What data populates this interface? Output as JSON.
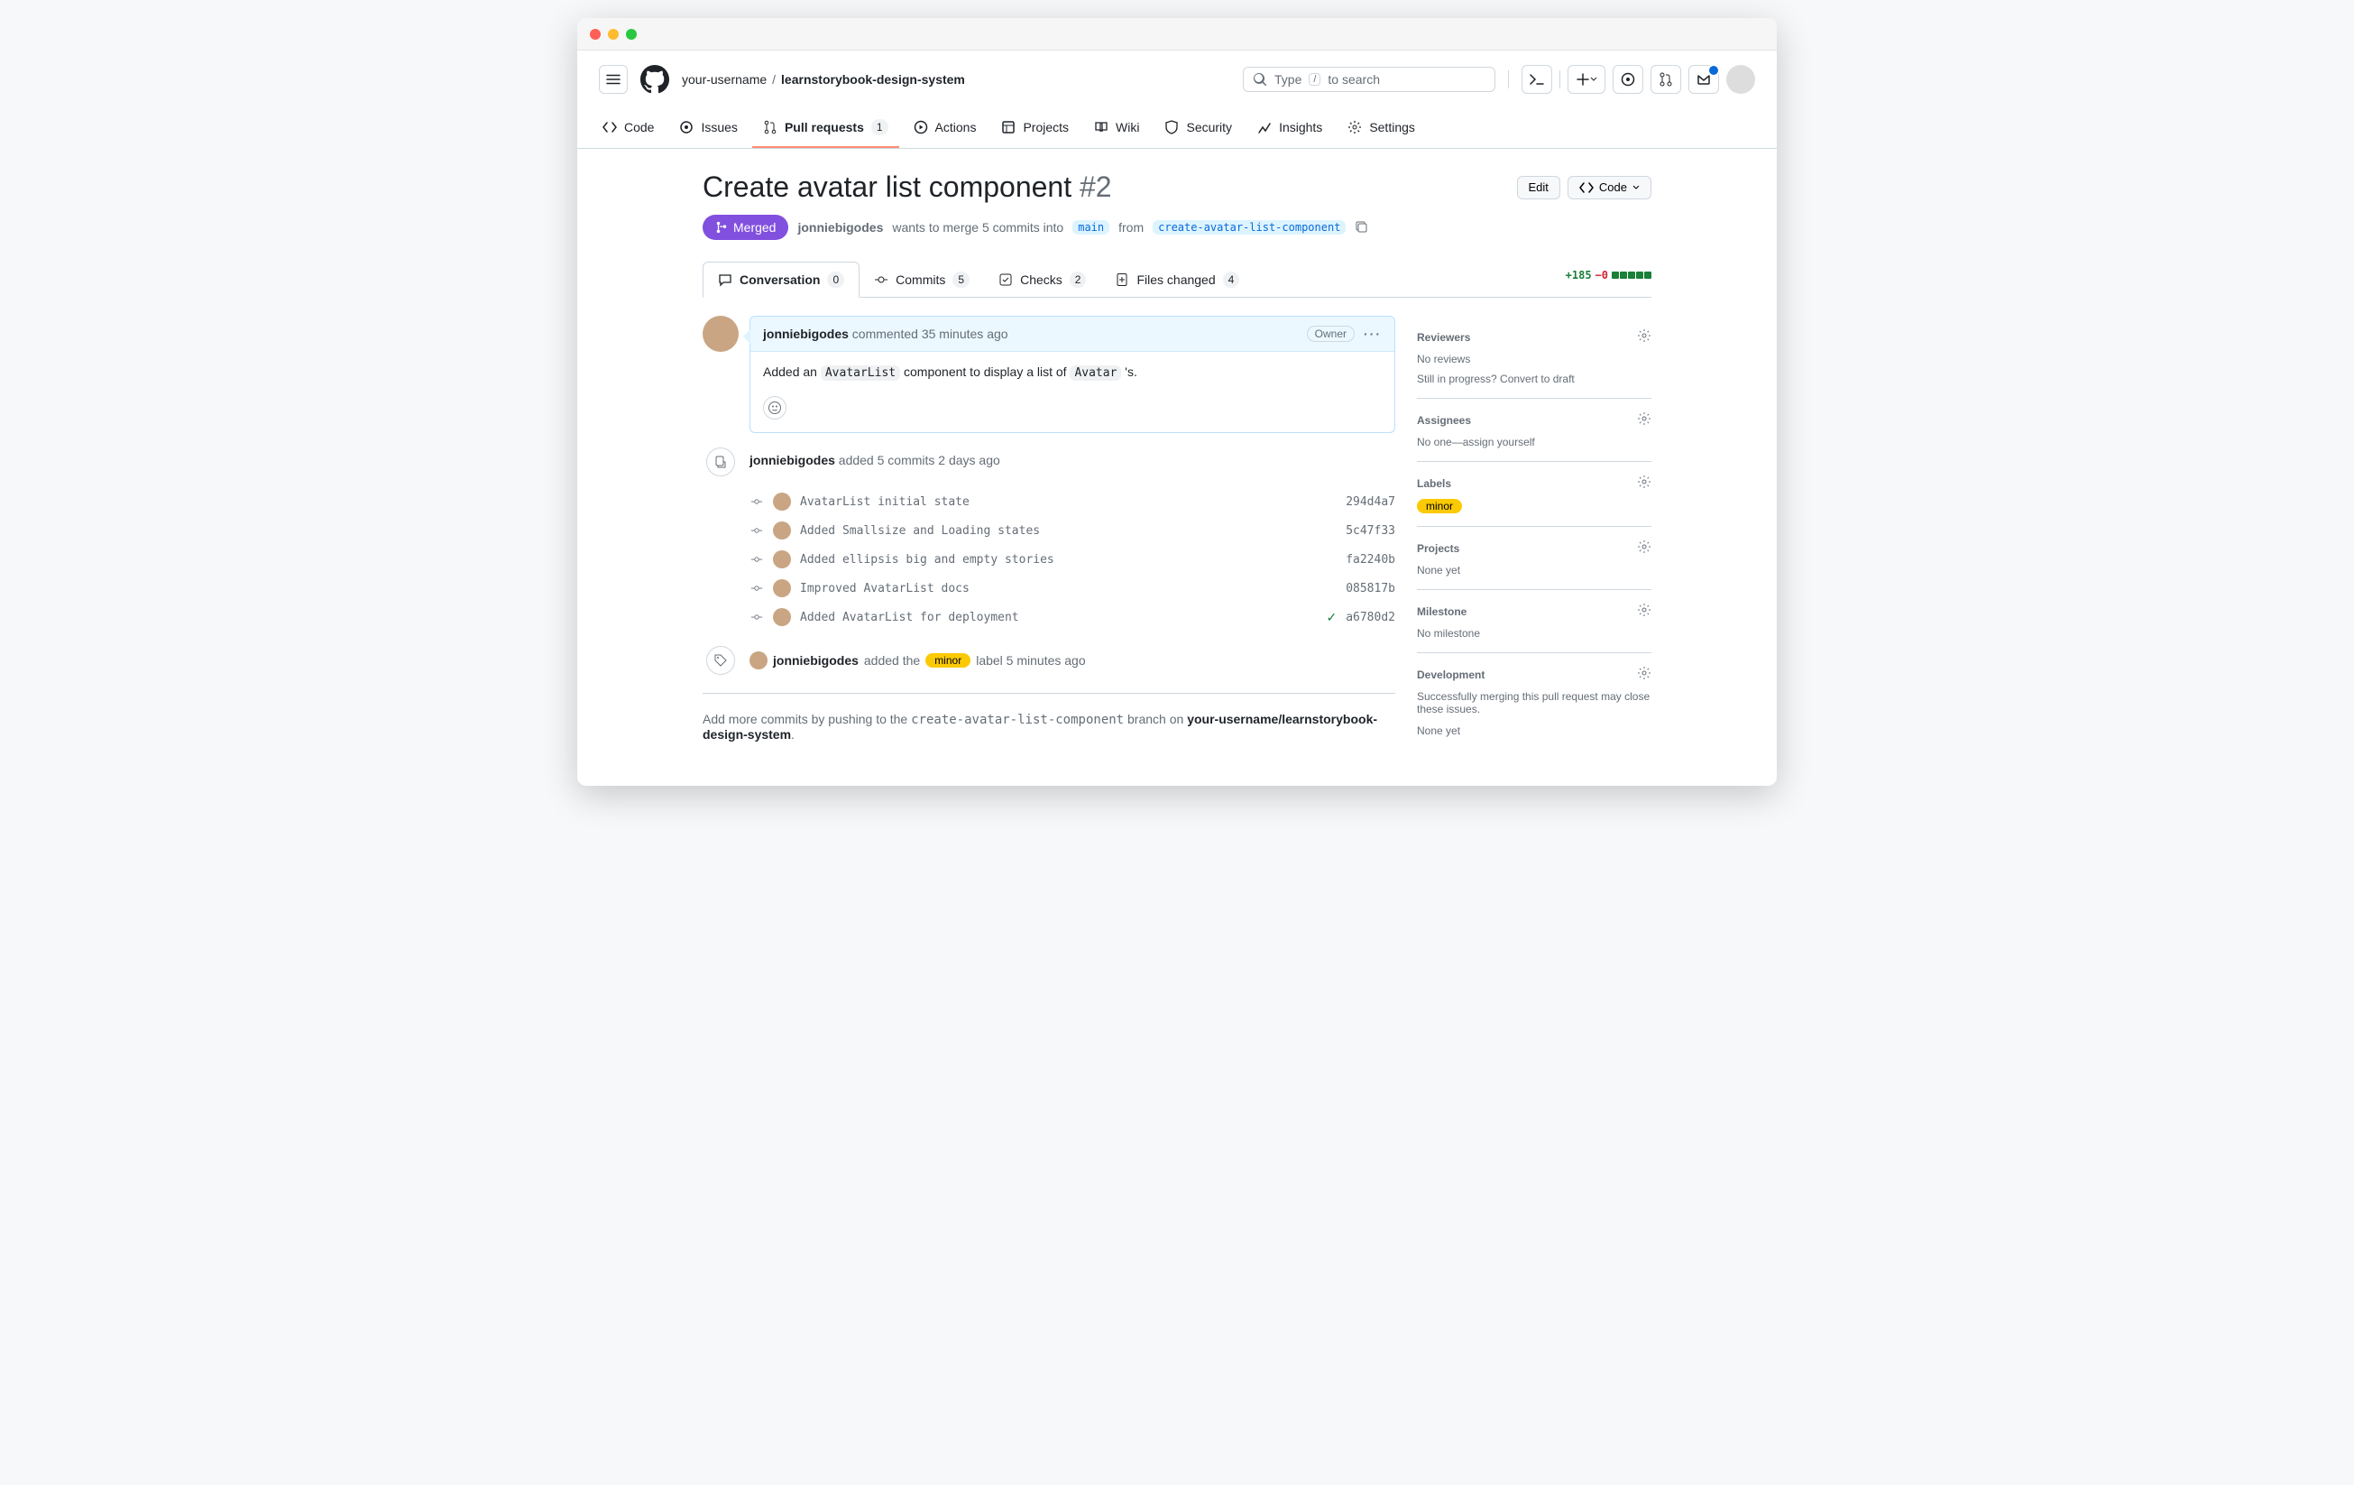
{
  "breadcrumb": {
    "owner": "your-username",
    "repo": "learnstorybook-design-system"
  },
  "search": {
    "prefix": "Type",
    "key": "/",
    "suffix": "to search"
  },
  "repo_nav": {
    "code": "Code",
    "issues": "Issues",
    "pull_requests": "Pull requests",
    "pr_count": "1",
    "actions": "Actions",
    "projects": "Projects",
    "wiki": "Wiki",
    "security": "Security",
    "insights": "Insights",
    "settings": "Settings"
  },
  "pr": {
    "title": "Create avatar list component",
    "number": "#2",
    "edit": "Edit",
    "code_btn": "Code",
    "state": "Merged",
    "author": "jonniebigodes",
    "meta_line_pre": "wants to merge 5 commits into",
    "base": "main",
    "from": "from",
    "head": "create-avatar-list-component"
  },
  "pr_tabs": {
    "conversation": "Conversation",
    "conv_count": "0",
    "commits": "Commits",
    "commits_count": "5",
    "checks": "Checks",
    "checks_count": "2",
    "files": "Files changed",
    "files_count": "4"
  },
  "diff": {
    "additions": "+185",
    "deletions": "−0"
  },
  "comment": {
    "author": "jonniebigodes",
    "timestamp": "commented 35 minutes ago",
    "owner_label": "Owner",
    "body_pre": "Added an ",
    "body_code1": "AvatarList",
    "body_mid": " component to display a list of ",
    "body_code2": "Avatar",
    "body_post": " 's."
  },
  "commits_event": {
    "author": "jonniebigodes",
    "text": "added 5 commits 2 days ago",
    "list": [
      {
        "msg": "AvatarList initial state",
        "sha": "294d4a7"
      },
      {
        "msg": "Added Smallsize and Loading states",
        "sha": "5c47f33"
      },
      {
        "msg": "Added ellipsis big and empty stories",
        "sha": "fa2240b"
      },
      {
        "msg": "Improved AvatarList docs",
        "sha": "085817b"
      },
      {
        "msg": "Added AvatarList for deployment",
        "sha": "a6780d2",
        "check": true
      }
    ]
  },
  "label_event": {
    "author": "jonniebigodes",
    "pre": "added the",
    "label": "minor",
    "post": "label 5 minutes ago"
  },
  "push_hint": {
    "pre": "Add more commits by pushing to the ",
    "branch": "create-avatar-list-component",
    "mid": " branch on ",
    "repo": "your-username/learnstorybook-design-system",
    "end": "."
  },
  "sidebar": {
    "reviewers": {
      "title": "Reviewers",
      "body": "No reviews",
      "hint_pre": "Still in progress? ",
      "hint_link": "Convert to draft"
    },
    "assignees": {
      "title": "Assignees",
      "body_pre": "No one—",
      "body_link": "assign yourself"
    },
    "labels": {
      "title": "Labels",
      "chip": "minor"
    },
    "projects": {
      "title": "Projects",
      "body": "None yet"
    },
    "milestone": {
      "title": "Milestone",
      "body": "No milestone"
    },
    "development": {
      "title": "Development",
      "body": "Successfully merging this pull request may close these issues.",
      "none": "None yet"
    }
  }
}
